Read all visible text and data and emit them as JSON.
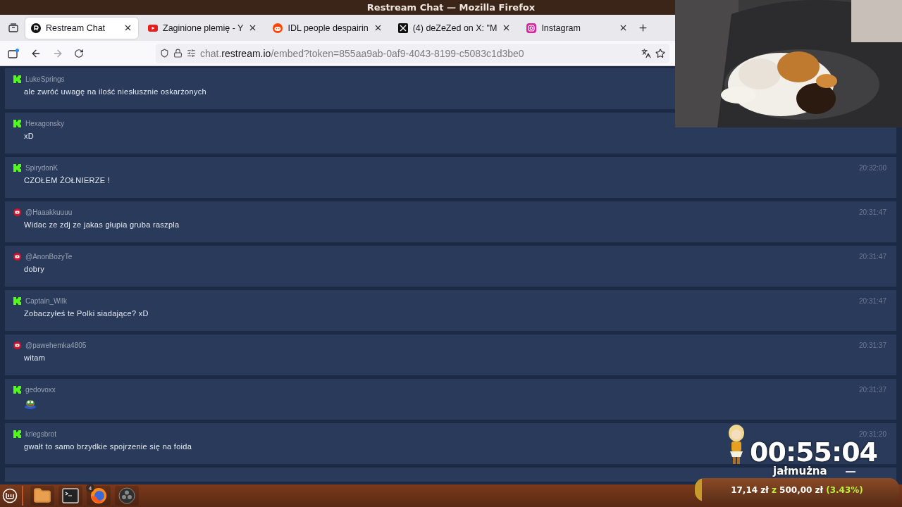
{
  "window": {
    "title": "Restream Chat — Mozilla Firefox"
  },
  "tabs": [
    {
      "title": "Restream Chat",
      "kind": "restream",
      "selected": true
    },
    {
      "title": "Zaginione plemię - Y",
      "kind": "youtube",
      "selected": false
    },
    {
      "title": "IDL people despairin",
      "kind": "reddit",
      "selected": false
    },
    {
      "title": "(4) deZeZed on X: \"M",
      "kind": "x",
      "selected": false
    },
    {
      "title": "Instagram",
      "kind": "instagram",
      "selected": false
    }
  ],
  "address_bar": {
    "prefix": "chat.",
    "host": "restream.io",
    "path": "/embed?token=855aa9ab-0af9-4043-8199-c5083c1d3be0"
  },
  "messages": [
    {
      "kind": "kick",
      "user": "LukeSprings",
      "emote": false,
      "text": "ale zwróć uwagę na ilość niesłusznie oskarżonych"
    },
    {
      "kind": "kick",
      "user": "Hexagonsky",
      "emote": false,
      "text": "xD"
    },
    {
      "kind": "kick",
      "user": "SpirydonK",
      "emote": false,
      "text": "CZOŁEM ŻOŁNIERZE !",
      "time": "20:32:00"
    },
    {
      "kind": "youtube",
      "user": "@Haaakkuuuu",
      "emote": false,
      "text": "Widac ze zdj ze jakas głupia gruba raszpla",
      "time": "20:31:47"
    },
    {
      "kind": "youtube",
      "user": "@AnonBożyTe",
      "emote": false,
      "text": "dobry",
      "time": "20:31:47"
    },
    {
      "kind": "kick",
      "user": "Captain_Wilk",
      "emote": false,
      "text": "Zobaczyłeś te Polki siadające? xD",
      "time": "20:31:47"
    },
    {
      "kind": "youtube",
      "user": "@pawehemka4805",
      "emote": false,
      "text": "witam",
      "time": "20:31:37"
    },
    {
      "kind": "kick",
      "user": "gedovoxx",
      "emote": true,
      "time": "20:31:37"
    },
    {
      "kind": "kick",
      "user": "kriegsbrot",
      "emote": false,
      "text": "gwałt to samo brzydkie spojrzenie się na foida",
      "time": "20:31:20"
    }
  ],
  "timer": {
    "time": "00:55:04",
    "label": "jałmużna"
  },
  "goal": {
    "raised": "17,14 zł",
    "separator": "z",
    "target": "500,00 zł",
    "percent": "(3.43%)",
    "level": 0.0343
  },
  "taskbar": {
    "apps": [
      {
        "kind": "files"
      },
      {
        "kind": "terminal"
      },
      {
        "kind": "firefox",
        "badge": "4"
      },
      {
        "kind": "obs"
      }
    ]
  }
}
